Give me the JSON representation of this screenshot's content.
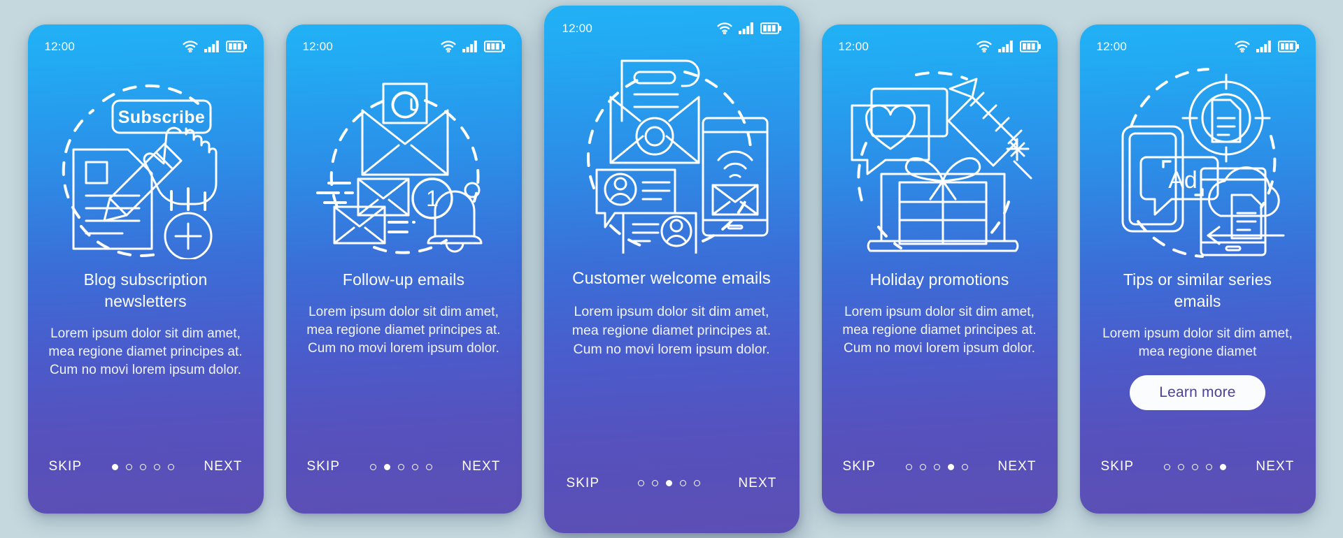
{
  "theme": {
    "page_background": "#c5d8de",
    "card_gradient_top": "#22b1f5",
    "card_gradient_bottom": "#5c4fb4",
    "accent_text": "#ffffff",
    "learn_more_text_color": "#4c3f9e",
    "learn_more_bg": "#fbfcfe"
  },
  "status_bar": {
    "time": "12:00",
    "icons": [
      "wifi-icon",
      "signal-icon",
      "battery-icon"
    ]
  },
  "nav": {
    "skip_label": "SKIP",
    "next_label": "NEXT",
    "total_steps": 5
  },
  "screens": [
    {
      "id": "blog-subscription-newsletters",
      "title": "Blog subscription newsletters",
      "description": "Lorem ipsum dolor sit dim amet, mea regione diamet principes at. Cum no movi lorem ipsum dolor.",
      "illustration": "subscribe-document-icon",
      "illustration_label": "Subscribe",
      "active_step": 1,
      "featured": false,
      "cta": null
    },
    {
      "id": "follow-up-emails",
      "title": "Follow-up emails",
      "description": "Lorem ipsum dolor sit dim amet, mea regione diamet principes at. Cum no movi lorem ipsum dolor.",
      "illustration": "email-at-bell-icon",
      "illustration_label": "1",
      "active_step": 2,
      "featured": false,
      "cta": null
    },
    {
      "id": "customer-welcome-emails",
      "title": "Customer welcome emails",
      "description": "Lorem ipsum dolor sit dim amet, mea regione diamet principes at. Cum no movi lorem ipsum dolor.",
      "illustration": "welcome-letter-chat-phone-icon",
      "illustration_label": "",
      "active_step": 3,
      "featured": true,
      "cta": null
    },
    {
      "id": "holiday-promotions",
      "title": "Holiday promotions",
      "description": "Lorem ipsum dolor sit dim amet, mea regione diamet principes at. Cum no movi lorem ipsum dolor.",
      "illustration": "gift-laptop-firework-icon",
      "illustration_label": "",
      "active_step": 4,
      "featured": false,
      "cta": null
    },
    {
      "id": "tips-or-similar-series-emails",
      "title": "Tips or similar series emails",
      "description": "Lorem ipsum dolor sit dim amet, mea regione diamet",
      "illustration": "ad-target-cloud-icon",
      "illustration_label": "Ad",
      "active_step": 5,
      "featured": false,
      "cta": "Learn more"
    }
  ]
}
